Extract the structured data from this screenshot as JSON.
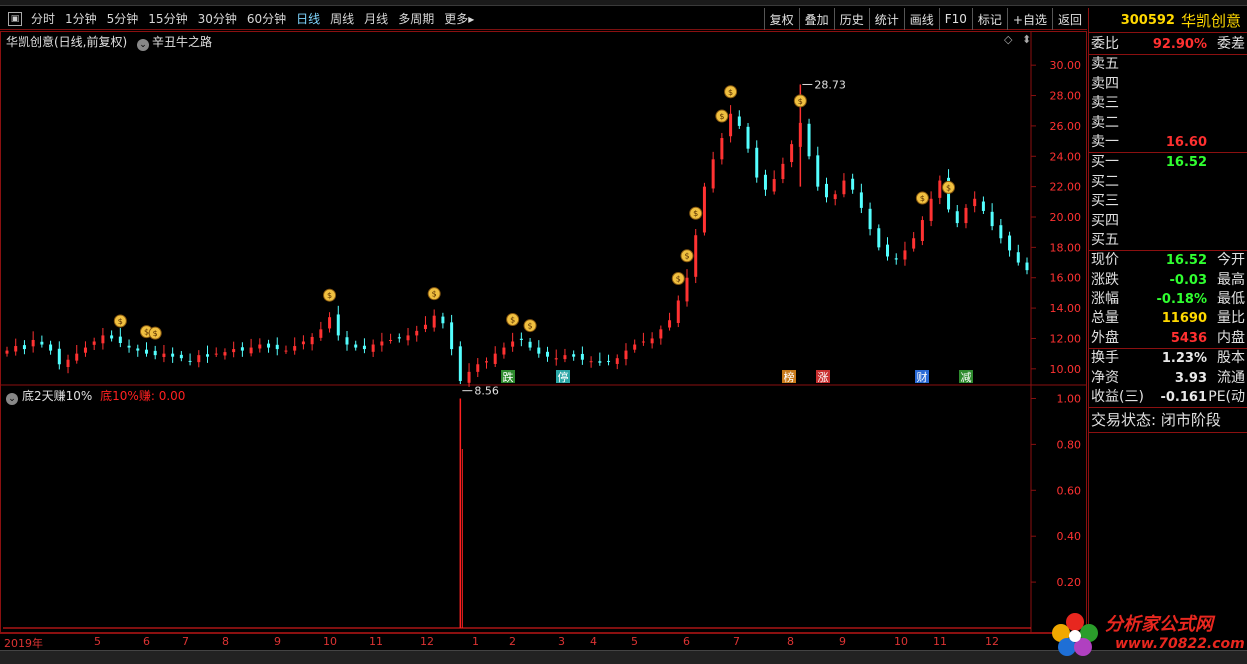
{
  "toolbar": {
    "periods": [
      "分时",
      "1分钟",
      "5分钟",
      "15分钟",
      "30分钟",
      "60分钟",
      "日线",
      "周线",
      "月线",
      "多周期",
      "更多"
    ],
    "active_period": "日线",
    "right_buttons": [
      "复权",
      "叠加",
      "历史",
      "统计",
      "画线",
      "F10",
      "标记",
      "+自选",
      "返回"
    ]
  },
  "main_chart": {
    "title": "华凯创意(日线,前复权)",
    "indicator": "辛丑牛之路",
    "high_label": "28.73",
    "low_label": "8.56",
    "y_ticks": [
      "30.00",
      "28.00",
      "26.00",
      "24.00",
      "22.00",
      "20.00",
      "18.00",
      "16.00",
      "14.00",
      "12.00",
      "10.00"
    ],
    "event_markers": [
      {
        "text": "跌",
        "color": "#2e8b2e"
      },
      {
        "text": "停",
        "color": "#2aa6a6"
      },
      {
        "text": "榜",
        "color": "#c87a1a"
      },
      {
        "text": "涨",
        "color": "#c83030"
      },
      {
        "text": "财",
        "color": "#2a6ad6"
      },
      {
        "text": "减",
        "color": "#2e8b2e"
      }
    ]
  },
  "sub_chart": {
    "title": "底2天赚10%",
    "series_label": "底10%赚:",
    "series_value": "0.00",
    "y_ticks": [
      "1.00",
      "0.80",
      "0.60",
      "0.40",
      "0.20"
    ]
  },
  "time_axis": {
    "labels": [
      "2019年",
      "5",
      "6",
      "7",
      "8",
      "9",
      "10",
      "11",
      "12",
      "1",
      "2",
      "3",
      "4",
      "5",
      "6",
      "7",
      "8",
      "9",
      "10",
      "11",
      "12"
    ]
  },
  "quote_panel": {
    "code": "300592",
    "name": "华凯创意",
    "weibi_label": "委比",
    "weibi_value": "92.90%",
    "weicha_label": "委差",
    "sell_labels": [
      "卖五",
      "卖四",
      "卖三",
      "卖二",
      "卖一"
    ],
    "sell1_price": "16.60",
    "buy_labels": [
      "买一",
      "买二",
      "买三",
      "买四",
      "买五"
    ],
    "buy1_price": "16.52",
    "stats": [
      {
        "label": "现价",
        "value": "16.52",
        "color": "green",
        "label2": "今开"
      },
      {
        "label": "涨跌",
        "value": "-0.03",
        "color": "green",
        "label2": "最高"
      },
      {
        "label": "涨幅",
        "value": "-0.18%",
        "color": "green",
        "label2": "最低"
      },
      {
        "label": "总量",
        "value": "11690",
        "color": "yellow",
        "label2": "量比"
      },
      {
        "label": "外盘",
        "value": "5436",
        "color": "red",
        "label2": "内盘"
      }
    ],
    "stats2": [
      {
        "label": "换手",
        "value": "1.23%",
        "color": "white",
        "label2": "股本"
      },
      {
        "label": "净资",
        "value": "3.93",
        "color": "white",
        "label2": "流通"
      },
      {
        "label": "收益(三)",
        "value": "-0.161",
        "color": "white",
        "label2": "PE(动"
      }
    ],
    "trade_status": "交易状态: 闭市阶段"
  },
  "watermark": {
    "text": "分析家公式网",
    "url": "www.70822.com"
  },
  "colors": {
    "up": "#ff3232",
    "down": "#54ffff",
    "grid": "#8b1010",
    "signal": "#ff2020"
  },
  "chart_data": {
    "type": "candlestick",
    "title": "华凯创意(日线,前复权)",
    "x_labels": [
      "2019年",
      "5",
      "6",
      "7",
      "8",
      "9",
      "10",
      "11",
      "12",
      "1",
      "2",
      "3",
      "4",
      "5",
      "6",
      "7",
      "8",
      "9",
      "10",
      "11",
      "12"
    ],
    "ylim": [
      9.0,
      31.0
    ],
    "close_path": [
      11.2,
      11.5,
      11.3,
      11.9,
      11.6,
      11.2,
      10.3,
      10.6,
      11.0,
      11.4,
      11.8,
      12.2,
      12.0,
      11.7,
      11.4,
      11.2,
      11.0,
      10.9,
      11.0,
      10.8,
      10.7,
      10.5,
      10.9,
      10.8,
      11.0,
      11.1,
      11.3,
      11.2,
      11.4,
      11.6,
      11.4,
      11.3,
      11.2,
      11.5,
      11.8,
      12.1,
      12.6,
      13.4,
      12.2,
      11.6,
      11.4,
      11.3,
      11.6,
      11.8,
      11.9,
      12.0,
      12.2,
      12.5,
      12.9,
      13.5,
      13.0,
      11.3,
      9.2,
      9.8,
      10.3,
      10.5,
      11.0,
      11.4,
      11.8,
      11.9,
      11.4,
      11.0,
      10.8,
      10.7,
      10.9,
      10.8,
      10.6,
      10.5,
      10.4,
      10.5,
      10.7,
      11.2,
      11.6,
      11.8,
      12.0,
      12.6,
      13.2,
      14.5,
      16.0,
      18.8,
      22.0,
      23.8,
      25.2,
      26.8,
      26.0,
      24.5,
      22.6,
      21.8,
      22.5,
      23.5,
      24.8,
      26.2,
      24.0,
      22.0,
      21.3,
      21.5,
      22.4,
      21.8,
      20.6,
      19.2,
      18.0,
      17.4,
      17.2,
      17.8,
      18.6,
      19.8,
      21.2,
      22.4,
      20.5,
      19.6,
      20.6,
      21.2,
      20.4,
      19.4,
      18.6,
      17.8,
      17.0,
      16.5
    ],
    "high_point": 28.73,
    "low_point": 8.56,
    "sub_series": {
      "name": "底10%赚",
      "ylim": [
        0,
        1.05
      ],
      "spike_index": 52,
      "spike_value": 1.0,
      "last_value": 0.0
    }
  }
}
